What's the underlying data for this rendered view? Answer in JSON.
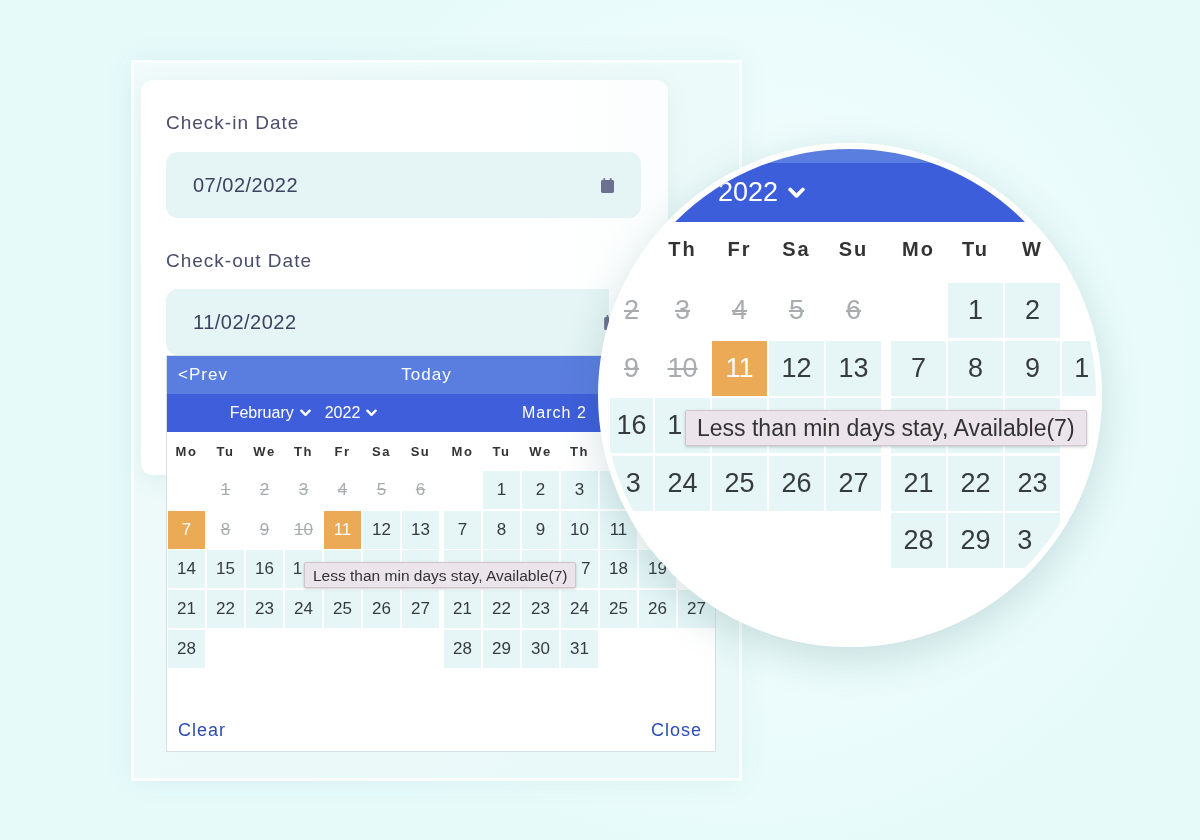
{
  "form": {
    "fields": [
      {
        "label": "Check-in Date",
        "value": "07/02/2022"
      },
      {
        "label": "Check-out Date",
        "value": "11/02/2022"
      }
    ]
  },
  "datepicker": {
    "prev": "<Prev",
    "today": "Today",
    "months": [
      {
        "header": {
          "kind": "selects",
          "month": "February",
          "year": "2022"
        },
        "weekdays": [
          "Mo",
          "Tu",
          "We",
          "Th",
          "Fr",
          "Sa",
          "Su"
        ],
        "weeks": [
          [
            {
              "kind": "blank"
            },
            {
              "kind": "day",
              "day": "1",
              "selected": false,
              "disabled": true
            },
            {
              "kind": "day",
              "day": "2",
              "selected": false,
              "disabled": true
            },
            {
              "kind": "day",
              "day": "3",
              "selected": false,
              "disabled": true
            },
            {
              "kind": "day",
              "day": "4",
              "selected": false,
              "disabled": true
            },
            {
              "kind": "day",
              "day": "5",
              "selected": false,
              "disabled": true
            },
            {
              "kind": "day",
              "day": "6",
              "selected": false,
              "disabled": true
            }
          ],
          [
            {
              "kind": "day",
              "day": "7",
              "selected": true,
              "disabled": false
            },
            {
              "kind": "day",
              "day": "8",
              "selected": false,
              "disabled": true
            },
            {
              "kind": "day",
              "day": "9",
              "selected": false,
              "disabled": true
            },
            {
              "kind": "day",
              "day": "10",
              "selected": false,
              "disabled": true
            },
            {
              "kind": "day",
              "day": "11",
              "selected": true,
              "disabled": false
            },
            {
              "kind": "day",
              "day": "12",
              "selected": false,
              "disabled": false
            },
            {
              "kind": "day",
              "day": "13",
              "selected": false,
              "disabled": false
            }
          ],
          [
            {
              "kind": "day",
              "day": "14",
              "selected": false,
              "disabled": false
            },
            {
              "kind": "day",
              "day": "15",
              "selected": false,
              "disabled": false
            },
            {
              "kind": "day",
              "day": "16",
              "selected": false,
              "disabled": false
            },
            {
              "kind": "head",
              "day": "1",
              "selected": false,
              "disabled": false
            },
            {
              "kind": "covered"
            },
            {
              "kind": "covered"
            },
            {
              "kind": "covered"
            }
          ],
          [
            {
              "kind": "day",
              "day": "21",
              "selected": false,
              "disabled": false
            },
            {
              "kind": "day",
              "day": "22",
              "selected": false,
              "disabled": false
            },
            {
              "kind": "day",
              "day": "23",
              "selected": false,
              "disabled": false
            },
            {
              "kind": "day",
              "day": "24",
              "selected": false,
              "disabled": false
            },
            {
              "kind": "day",
              "day": "25",
              "selected": false,
              "disabled": false
            },
            {
              "kind": "day",
              "day": "26",
              "selected": false,
              "disabled": false
            },
            {
              "kind": "day",
              "day": "27",
              "selected": false,
              "disabled": false
            }
          ],
          [
            {
              "kind": "day",
              "day": "28",
              "selected": false,
              "disabled": false
            }
          ]
        ]
      },
      {
        "header": {
          "kind": "title",
          "text": "March 2"
        },
        "weekdays": [
          "Mo",
          "Tu",
          "We",
          "Th"
        ],
        "weeks": [
          [
            {
              "kind": "blank"
            },
            {
              "kind": "day",
              "day": "1",
              "selected": false,
              "disabled": false
            },
            {
              "kind": "day",
              "day": "2",
              "selected": false,
              "disabled": false
            },
            {
              "kind": "day",
              "day": "3",
              "selected": false,
              "disabled": false
            },
            {
              "kind": "covered"
            }
          ],
          [
            {
              "kind": "day",
              "day": "7",
              "selected": false,
              "disabled": false
            },
            {
              "kind": "day",
              "day": "8",
              "selected": false,
              "disabled": false
            },
            {
              "kind": "day",
              "day": "9",
              "selected": false,
              "disabled": false
            },
            {
              "kind": "day",
              "day": "10",
              "selected": false,
              "disabled": false
            },
            {
              "kind": "day",
              "day": "11",
              "selected": false,
              "disabled": false
            }
          ],
          [
            {
              "kind": "covered"
            },
            {
              "kind": "covered"
            },
            {
              "kind": "covered"
            },
            {
              "kind": "tail",
              "day": "7",
              "selected": false,
              "disabled": false
            },
            {
              "kind": "day",
              "day": "18",
              "selected": false,
              "disabled": false
            },
            {
              "kind": "day",
              "day": "19",
              "selected": false,
              "disabled": false
            }
          ],
          [
            {
              "kind": "day",
              "day": "21",
              "selected": false,
              "disabled": false
            },
            {
              "kind": "day",
              "day": "22",
              "selected": false,
              "disabled": false
            },
            {
              "kind": "day",
              "day": "23",
              "selected": false,
              "disabled": false
            },
            {
              "kind": "day",
              "day": "24",
              "selected": false,
              "disabled": false
            },
            {
              "kind": "day",
              "day": "25",
              "selected": false,
              "disabled": false
            },
            {
              "kind": "day",
              "day": "26",
              "selected": false,
              "disabled": false
            },
            {
              "kind": "day",
              "day": "27",
              "selected": false,
              "disabled": false
            }
          ],
          [
            {
              "kind": "day",
              "day": "28",
              "selected": false,
              "disabled": false
            },
            {
              "kind": "day",
              "day": "29",
              "selected": false,
              "disabled": false
            },
            {
              "kind": "day",
              "day": "30",
              "selected": false,
              "disabled": false
            },
            {
              "kind": "day",
              "day": "31",
              "selected": false,
              "disabled": false
            }
          ]
        ]
      }
    ],
    "tooltip": "Less than min days stay, Available(7)",
    "clear": "Clear",
    "close": "Close"
  },
  "magnifier": {
    "year": "2022",
    "months": [
      {
        "weekdays": [
          "Th",
          "Fr",
          "Sa",
          "Su"
        ],
        "weeks": [
          [
            {
              "kind": "day",
              "day": "2",
              "selected": false,
              "disabled": true
            },
            {
              "kind": "day",
              "day": "3",
              "selected": false,
              "disabled": true
            },
            {
              "kind": "day",
              "day": "4",
              "selected": false,
              "disabled": true
            },
            {
              "kind": "day",
              "day": "5",
              "selected": false,
              "disabled": true
            },
            {
              "kind": "day",
              "day": "6",
              "selected": false,
              "disabled": true
            }
          ],
          [
            {
              "kind": "day",
              "day": "9",
              "selected": false,
              "disabled": true
            },
            {
              "kind": "day",
              "day": "10",
              "selected": false,
              "disabled": true
            },
            {
              "kind": "day",
              "day": "11",
              "selected": true,
              "disabled": false
            },
            {
              "kind": "day",
              "day": "12",
              "selected": false,
              "disabled": false
            },
            {
              "kind": "day",
              "day": "13",
              "selected": false,
              "disabled": false
            }
          ],
          [
            {
              "kind": "day",
              "day": "16",
              "selected": false,
              "disabled": false
            },
            {
              "kind": "head",
              "day": "1",
              "selected": false,
              "disabled": false
            },
            {
              "kind": "covered"
            },
            {
              "kind": "covered"
            },
            {
              "kind": "covered"
            }
          ],
          [
            {
              "kind": "tail",
              "day": "3",
              "selected": false,
              "disabled": false
            },
            {
              "kind": "day",
              "day": "24",
              "selected": false,
              "disabled": false
            },
            {
              "kind": "day",
              "day": "25",
              "selected": false,
              "disabled": false
            },
            {
              "kind": "day",
              "day": "26",
              "selected": false,
              "disabled": false
            },
            {
              "kind": "day",
              "day": "27",
              "selected": false,
              "disabled": false
            }
          ]
        ]
      },
      {
        "weekdays": [
          "Mo",
          "Tu",
          "W"
        ],
        "weeks": [
          [
            {
              "kind": "blank"
            },
            {
              "kind": "day",
              "day": "1",
              "selected": false,
              "disabled": false
            },
            {
              "kind": "day",
              "day": "2",
              "selected": false,
              "disabled": false
            }
          ],
          [
            {
              "kind": "day",
              "day": "7",
              "selected": false,
              "disabled": false
            },
            {
              "kind": "day",
              "day": "8",
              "selected": false,
              "disabled": false
            },
            {
              "kind": "day",
              "day": "9",
              "selected": false,
              "disabled": false
            },
            {
              "kind": "head",
              "day": "1",
              "selected": false,
              "disabled": false
            }
          ],
          [
            {
              "kind": "covered"
            },
            {
              "kind": "covered"
            },
            {
              "kind": "covered"
            }
          ],
          [
            {
              "kind": "day",
              "day": "21",
              "selected": false,
              "disabled": false
            },
            {
              "kind": "day",
              "day": "22",
              "selected": false,
              "disabled": false
            },
            {
              "kind": "day",
              "day": "23",
              "selected": false,
              "disabled": false
            }
          ],
          [
            {
              "kind": "day",
              "day": "28",
              "selected": false,
              "disabled": false
            },
            {
              "kind": "day",
              "day": "29",
              "selected": false,
              "disabled": false
            },
            {
              "kind": "head",
              "day": "3",
              "selected": false,
              "disabled": false
            }
          ]
        ]
      }
    ],
    "tooltip": "Less than min days stay, Available(7)"
  }
}
